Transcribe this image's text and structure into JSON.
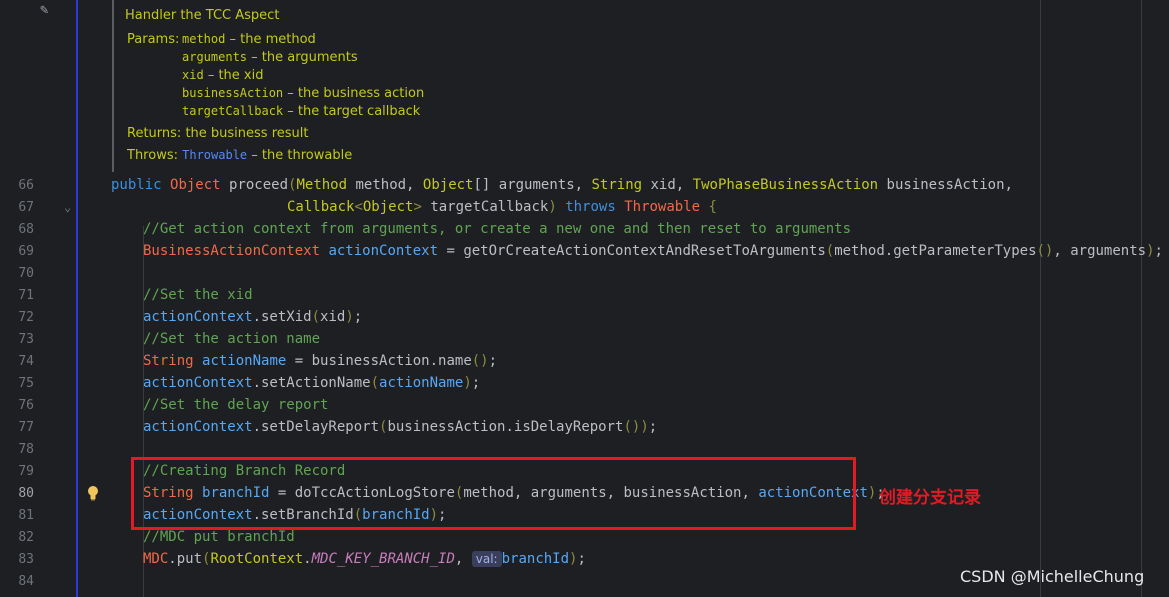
{
  "doc": {
    "heading": "Handler the TCC Aspect",
    "params_label": "Params:",
    "params": [
      {
        "name": "method",
        "desc": " – the method"
      },
      {
        "name": "arguments",
        "desc": " – the arguments"
      },
      {
        "name": "xid",
        "desc": " – the xid"
      },
      {
        "name": "businessAction",
        "desc": " – the business action"
      },
      {
        "name": "targetCallback",
        "desc": " – the target callback"
      }
    ],
    "returns_label": "Returns:",
    "returns_text": "the business result",
    "throws_label": "Throws:",
    "throws_type": "Throwable",
    "throws_text": " – the throwable"
  },
  "line_numbers": [
    "66",
    "67",
    "68",
    "69",
    "70",
    "71",
    "72",
    "73",
    "74",
    "75",
    "76",
    "77",
    "78",
    "79",
    "80",
    "81",
    "82",
    "83",
    "84"
  ],
  "comments": {
    "c68": "//Get action context from arguments, or create a new one and then reset to arguments",
    "c71": "//Set the xid",
    "c73": "//Set the action name",
    "c76": "//Set the delay report",
    "c79": "//Creating Branch Record",
    "c82": "//MDC put branchId"
  },
  "inlay_hint": "val:",
  "annotation": "创建分支记录",
  "watermark": "CSDN @MichelleChung",
  "colors": {
    "highlight_box": "#e01b24",
    "keyword": "#cf8e6d",
    "comment": "#5fa552",
    "doc_text": "#c3c91f",
    "background": "#1e1f22"
  }
}
